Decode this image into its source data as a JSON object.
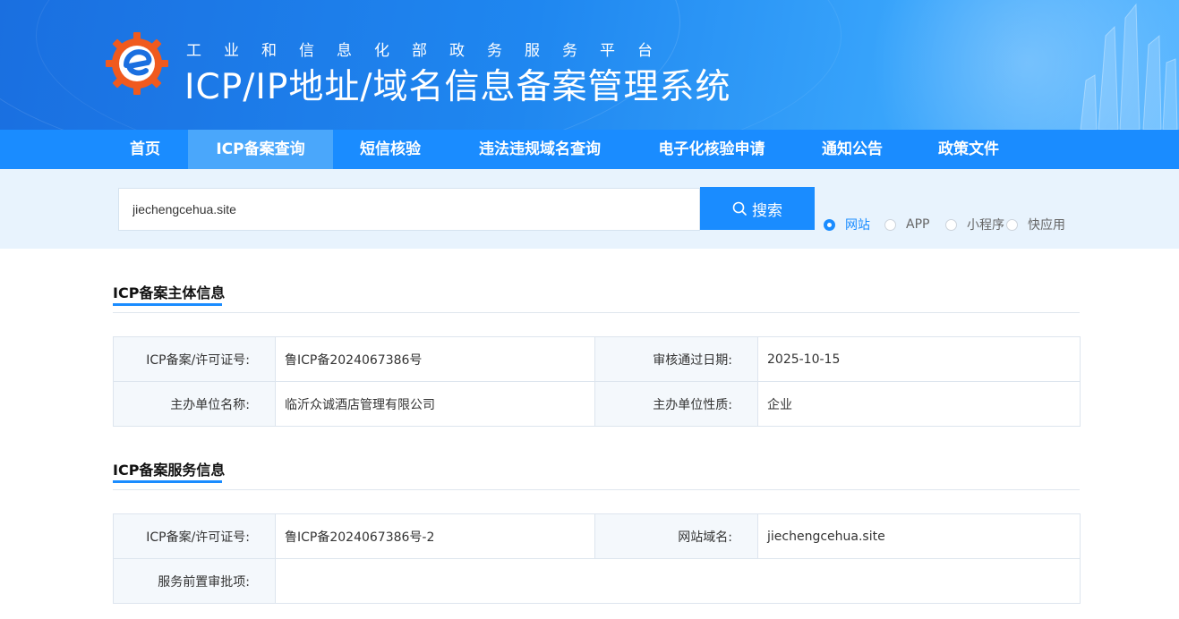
{
  "header": {
    "subtitle": "工业和信息化部政务服务平台",
    "title": "ICP/IP地址/域名信息备案管理系统",
    "logo_icon": "gear-e-logo-icon"
  },
  "nav": {
    "items": [
      {
        "label": "首页",
        "active": false
      },
      {
        "label": "ICP备案查询",
        "active": true
      },
      {
        "label": "短信核验",
        "active": false
      },
      {
        "label": "违法违规域名查询",
        "active": false
      },
      {
        "label": "电子化核验申请",
        "active": false
      },
      {
        "label": "通知公告",
        "active": false
      },
      {
        "label": "政策文件",
        "active": false
      }
    ]
  },
  "search": {
    "value": "jiechengcehua.site",
    "button_label": "搜索",
    "button_icon": "search-icon",
    "types": [
      {
        "label": "网站",
        "checked": true
      },
      {
        "label": "APP",
        "checked": false
      },
      {
        "label": "小程序",
        "checked": false
      },
      {
        "label": "快应用",
        "checked": false
      }
    ]
  },
  "subject_info": {
    "title": "ICP备案主体信息",
    "rows": [
      [
        {
          "label": "ICP备案/许可证号:",
          "value": "鲁ICP备2024067386号"
        },
        {
          "label": "审核通过日期:",
          "value": "2025-10-15"
        }
      ],
      [
        {
          "label": "主办单位名称:",
          "value": "临沂众诚酒店管理有限公司"
        },
        {
          "label": "主办单位性质:",
          "value": "企业"
        }
      ]
    ]
  },
  "service_info": {
    "title": "ICP备案服务信息",
    "license_label": "ICP备案/许可证号:",
    "license_value": "鲁ICP备2024067386号-2",
    "domain_label": "网站域名:",
    "domain_value": "jiechengcehua.site",
    "approval_label": "服务前置审批项:",
    "approval_value": ""
  },
  "colors": {
    "primary": "#1a8cff",
    "nav_active": "#4aa7fb",
    "search_band": "#e8f3fd",
    "label_bg": "#f4f8fc",
    "logo_orange": "#f05a1e"
  }
}
